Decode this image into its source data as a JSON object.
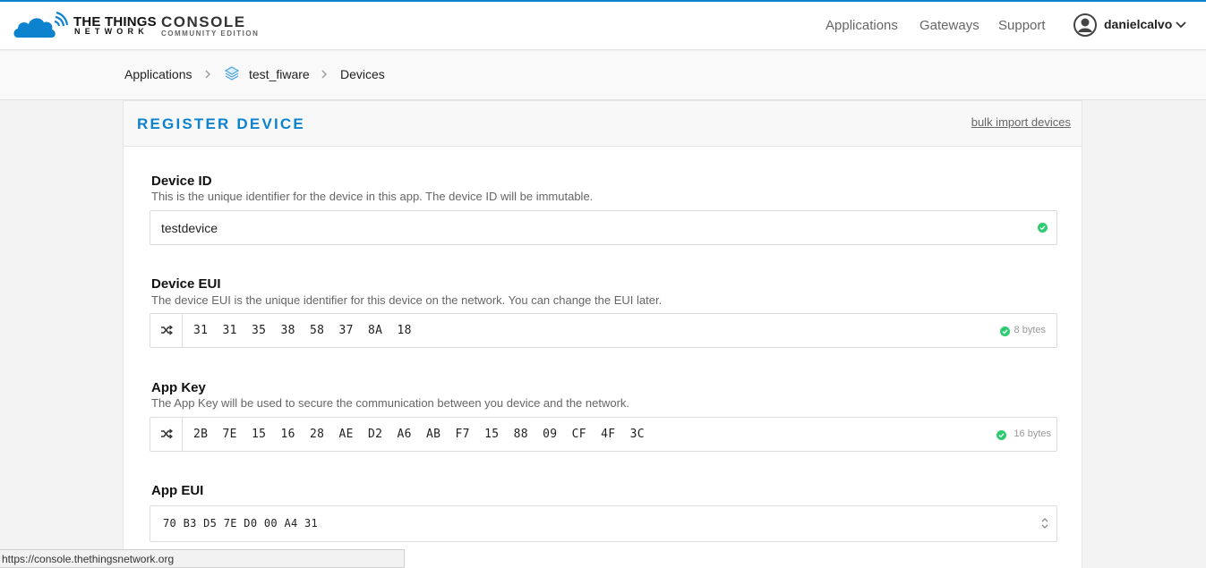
{
  "header": {
    "brand_top": "THE THINGS",
    "brand_bottom": "NETWORK",
    "console_title": "CONSOLE",
    "console_subtitle": "COMMUNITY EDITION",
    "nav": [
      "Applications",
      "Gateways",
      "Support"
    ],
    "user": "danielcalvo",
    "accent_color": "#0d83d0"
  },
  "breadcrumb": {
    "items": [
      "Applications",
      "test_fiware",
      "Devices"
    ],
    "app_icon": "layers-icon"
  },
  "card": {
    "title": "REGISTER DEVICE",
    "bulk_link": "bulk import devices"
  },
  "fields": {
    "device_id": {
      "label": "Device ID",
      "description": "This is the unique identifier for the device in this app. The device ID will be immutable.",
      "value": "testdevice"
    },
    "device_eui": {
      "label": "Device EUI",
      "description": "The device EUI is the unique identifier for this device on the network. You can change the EUI later.",
      "value": "31  31  35  38  58  37  8A  18",
      "bytes": "8 bytes"
    },
    "app_key": {
      "label": "App Key",
      "description": "The App Key will be used to secure the communication between you device and the network.",
      "value": "2B  7E  15  16  28  AE  D2  A6  AB  F7  15  88  09  CF  4F  3C",
      "bytes": "16 bytes"
    },
    "app_eui": {
      "label": "App EUI",
      "value": "70 B3 D5 7E D0 00 A4 31"
    }
  },
  "statusbar": {
    "url": "https://console.thethingsnetwork.org"
  },
  "colors": {
    "valid": "#2ecc71",
    "background": "#f3f3f3"
  }
}
